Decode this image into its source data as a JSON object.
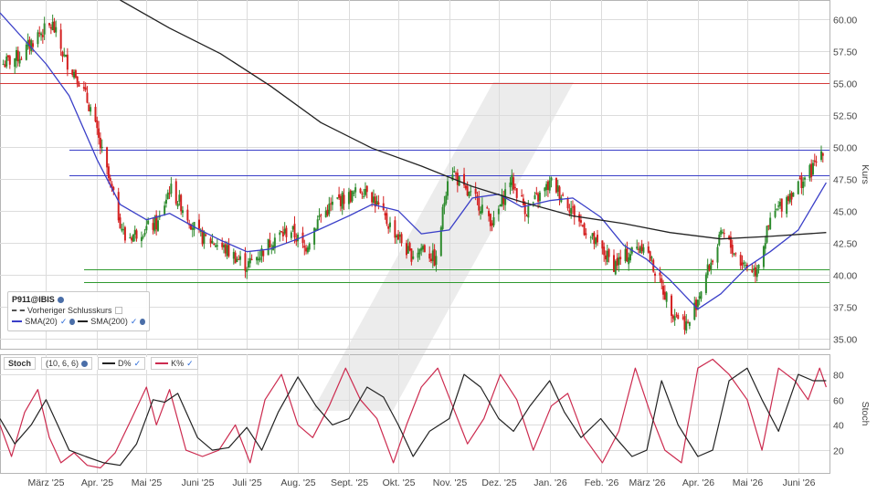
{
  "chart_data": [
    {
      "type": "candlestick",
      "symbol": "P911@IBIS",
      "ylabel": "Kurs",
      "ylim": [
        34.2,
        61.5
      ],
      "yticks": [
        35.0,
        37.5,
        40.0,
        42.5,
        45.0,
        47.5,
        50.0,
        52.5,
        55.0,
        57.5,
        60.0
      ],
      "ytick_labels": [
        "35.00",
        "37.50",
        "40.00",
        "42.50",
        "45.00",
        "47.50",
        "50.00",
        "52.50",
        "55.00",
        "57.50",
        "60.00"
      ],
      "x_labels": [
        "März '25",
        "Apr. '25",
        "Mai '25",
        "Juni '25",
        "Juli '25",
        "Aug. '25",
        "Sept. '25",
        "Okt. '25",
        "Nov. '25",
        "Dez. '25",
        "Jan. '26",
        "Feb. '26",
        "März '26",
        "Apr. '26",
        "Mai '26",
        "Juni '26"
      ],
      "x_dates": [
        "2025-03-01",
        "2025-04-01",
        "2025-05-01",
        "2025-06-01",
        "2025-07-01",
        "2025-08-01",
        "2025-09-01",
        "2025-10-01",
        "2025-11-01",
        "2025-12-01",
        "2026-01-01",
        "2026-02-01",
        "2026-03-01",
        "2026-04-01",
        "2026-05-01",
        "2026-06-01"
      ],
      "x_range": [
        "2025-02-01",
        "2026-06-20"
      ],
      "close_dates": [
        "2025-02-03",
        "2025-02-14",
        "2025-02-24",
        "2025-03-05",
        "2025-03-12",
        "2025-03-20",
        "2025-03-28",
        "2025-04-04",
        "2025-04-10",
        "2025-04-18",
        "2025-04-28",
        "2025-05-08",
        "2025-05-15",
        "2025-05-22",
        "2025-06-02",
        "2025-06-12",
        "2025-06-23",
        "2025-07-01",
        "2025-07-10",
        "2025-07-18",
        "2025-07-28",
        "2025-08-05",
        "2025-08-14",
        "2025-08-25",
        "2025-09-03",
        "2025-09-12",
        "2025-09-22",
        "2025-10-01",
        "2025-10-08",
        "2025-10-16",
        "2025-10-24",
        "2025-11-01",
        "2025-11-10",
        "2025-11-20",
        "2025-11-28",
        "2025-12-08",
        "2025-12-18",
        "2026-01-02",
        "2026-01-10",
        "2026-01-20",
        "2026-01-30",
        "2026-02-09",
        "2026-02-18",
        "2026-02-27",
        "2026-03-06",
        "2026-03-16",
        "2026-03-26",
        "2026-04-06",
        "2026-04-16",
        "2026-04-27",
        "2026-05-06",
        "2026-05-16",
        "2026-05-26",
        "2026-06-03",
        "2026-06-10",
        "2026-06-16"
      ],
      "closes": [
        56.5,
        57.2,
        58.8,
        59.5,
        57.0,
        55.5,
        53.0,
        49.5,
        46.5,
        42.8,
        43.5,
        44.0,
        46.8,
        45.5,
        43.0,
        42.5,
        41.5,
        40.7,
        41.8,
        42.9,
        43.5,
        42.0,
        44.5,
        45.8,
        46.2,
        46.9,
        44.5,
        43.0,
        41.5,
        42.2,
        41.0,
        48.7,
        46.5,
        45.5,
        44.0,
        47.5,
        45.0,
        47.2,
        46.0,
        44.0,
        42.2,
        40.8,
        41.6,
        42.5,
        40.3,
        37.3,
        36.0,
        40.0,
        43.2,
        41.0,
        40.3,
        44.5,
        46.2,
        47.3,
        48.3,
        49.9
      ],
      "series": [
        {
          "name": "SMA(20)",
          "color": "#3a3fc8",
          "dates": [
            "2025-02-01",
            "2025-02-15",
            "2025-03-01",
            "2025-03-15",
            "2025-04-01",
            "2025-04-15",
            "2025-05-01",
            "2025-05-15",
            "2025-06-01",
            "2025-06-15",
            "2025-07-01",
            "2025-07-15",
            "2025-08-01",
            "2025-08-15",
            "2025-09-01",
            "2025-09-15",
            "2025-10-01",
            "2025-10-15",
            "2025-11-01",
            "2025-11-15",
            "2025-12-01",
            "2025-12-15",
            "2026-01-01",
            "2026-01-15",
            "2026-02-01",
            "2026-02-15",
            "2026-03-01",
            "2026-03-15",
            "2026-04-01",
            "2026-04-15",
            "2026-05-01",
            "2026-05-15",
            "2026-06-01",
            "2026-06-18"
          ],
          "values": [
            60.5,
            58.5,
            56.5,
            54.0,
            49.0,
            45.5,
            44.3,
            44.8,
            43.6,
            42.7,
            41.8,
            42.0,
            42.8,
            43.6,
            44.6,
            45.5,
            45.0,
            43.2,
            43.5,
            46.0,
            46.3,
            45.3,
            45.8,
            46.0,
            44.5,
            42.3,
            41.2,
            39.6,
            37.3,
            38.5,
            40.6,
            41.8,
            43.5,
            47.2
          ]
        },
        {
          "name": "SMA(200)",
          "color": "#222222",
          "dates": [
            "2025-04-15",
            "2025-05-15",
            "2025-06-15",
            "2025-07-15",
            "2025-08-15",
            "2025-09-15",
            "2025-10-15",
            "2025-11-15",
            "2025-12-15",
            "2026-01-15",
            "2026-02-15",
            "2026-03-15",
            "2026-04-15",
            "2026-05-15",
            "2026-06-18"
          ],
          "values": [
            61.5,
            59.3,
            57.3,
            54.8,
            51.9,
            49.9,
            48.5,
            46.9,
            45.7,
            44.6,
            44.0,
            43.3,
            42.8,
            43.0,
            43.3
          ]
        }
      ],
      "hlines": [
        {
          "value": 55.8,
          "color": "#d43a3a"
        },
        {
          "value": 55.0,
          "color": "#d43a3a"
        },
        {
          "value": 49.8,
          "color": "#3a3fc8"
        },
        {
          "value": 47.8,
          "color": "#3a3fc8"
        },
        {
          "value": 40.4,
          "color": "#2f9a2f"
        },
        {
          "value": 39.4,
          "color": "#2f9a2f"
        }
      ],
      "legend": [
        {
          "label": "P911@IBIS"
        },
        {
          "label": "Vorheriger Schlusskurs"
        },
        {
          "label": "SMA(20)"
        },
        {
          "label": "SMA(200)"
        }
      ]
    },
    {
      "type": "line",
      "title": "Stoch",
      "params": "(10, 6, 6)",
      "ylabel": "Stoch",
      "ylim": [
        2,
        96
      ],
      "yticks": [
        20,
        40,
        60,
        80
      ],
      "ytick_labels": [
        "20",
        "40",
        "60",
        "80"
      ],
      "series": [
        {
          "name": "D%",
          "color": "#222222",
          "dates": [
            "2025-02-01",
            "2025-02-10",
            "2025-02-20",
            "2025-03-01",
            "2025-03-08",
            "2025-03-15",
            "2025-03-25",
            "2025-04-05",
            "2025-04-15",
            "2025-04-25",
            "2025-05-05",
            "2025-05-12",
            "2025-05-20",
            "2025-06-01",
            "2025-06-10",
            "2025-06-20",
            "2025-07-01",
            "2025-07-10",
            "2025-07-20",
            "2025-08-01",
            "2025-08-12",
            "2025-08-22",
            "2025-09-01",
            "2025-09-12",
            "2025-09-22",
            "2025-10-01",
            "2025-10-10",
            "2025-10-20",
            "2025-11-01",
            "2025-11-10",
            "2025-11-20",
            "2025-12-01",
            "2025-12-10",
            "2025-12-20",
            "2026-01-01",
            "2026-01-10",
            "2026-01-20",
            "2026-02-01",
            "2026-02-10",
            "2026-02-20",
            "2026-03-01",
            "2026-03-10",
            "2026-03-20",
            "2026-04-01",
            "2026-04-10",
            "2026-04-20",
            "2026-05-01",
            "2026-05-10",
            "2026-05-20",
            "2026-06-01",
            "2026-06-10",
            "2026-06-18"
          ],
          "values": [
            45,
            25,
            40,
            60,
            40,
            20,
            15,
            10,
            8,
            25,
            60,
            58,
            65,
            30,
            20,
            22,
            38,
            20,
            50,
            78,
            55,
            40,
            45,
            70,
            62,
            40,
            15,
            35,
            45,
            80,
            70,
            45,
            35,
            55,
            75,
            50,
            30,
            45,
            30,
            15,
            20,
            75,
            40,
            15,
            20,
            75,
            85,
            60,
            35,
            80,
            75,
            75
          ]
        },
        {
          "name": "K%",
          "color": "#cc2b4f",
          "dates": [
            "2025-02-01",
            "2025-02-08",
            "2025-02-16",
            "2025-02-24",
            "2025-03-03",
            "2025-03-10",
            "2025-03-18",
            "2025-03-26",
            "2025-04-03",
            "2025-04-12",
            "2025-04-22",
            "2025-05-01",
            "2025-05-07",
            "2025-05-15",
            "2025-05-25",
            "2025-06-04",
            "2025-06-14",
            "2025-06-24",
            "2025-07-03",
            "2025-07-12",
            "2025-07-22",
            "2025-08-01",
            "2025-08-10",
            "2025-08-20",
            "2025-08-30",
            "2025-09-08",
            "2025-09-18",
            "2025-09-28",
            "2025-10-06",
            "2025-10-15",
            "2025-10-25",
            "2025-11-03",
            "2025-11-12",
            "2025-11-22",
            "2025-12-02",
            "2025-12-12",
            "2025-12-22",
            "2026-01-02",
            "2026-01-12",
            "2026-01-22",
            "2026-02-02",
            "2026-02-12",
            "2026-02-22",
            "2026-03-03",
            "2026-03-12",
            "2026-03-22",
            "2026-04-01",
            "2026-04-10",
            "2026-04-20",
            "2026-05-01",
            "2026-05-10",
            "2026-05-20",
            "2026-05-30",
            "2026-06-07",
            "2026-06-14",
            "2026-06-18"
          ],
          "values": [
            40,
            15,
            50,
            68,
            30,
            10,
            18,
            8,
            6,
            18,
            45,
            70,
            40,
            68,
            20,
            15,
            20,
            40,
            10,
            60,
            80,
            40,
            30,
            55,
            85,
            60,
            45,
            10,
            40,
            70,
            85,
            55,
            25,
            45,
            80,
            60,
            20,
            55,
            65,
            30,
            10,
            35,
            85,
            50,
            20,
            10,
            85,
            92,
            80,
            60,
            20,
            85,
            75,
            60,
            85,
            70
          ]
        }
      ]
    }
  ]
}
